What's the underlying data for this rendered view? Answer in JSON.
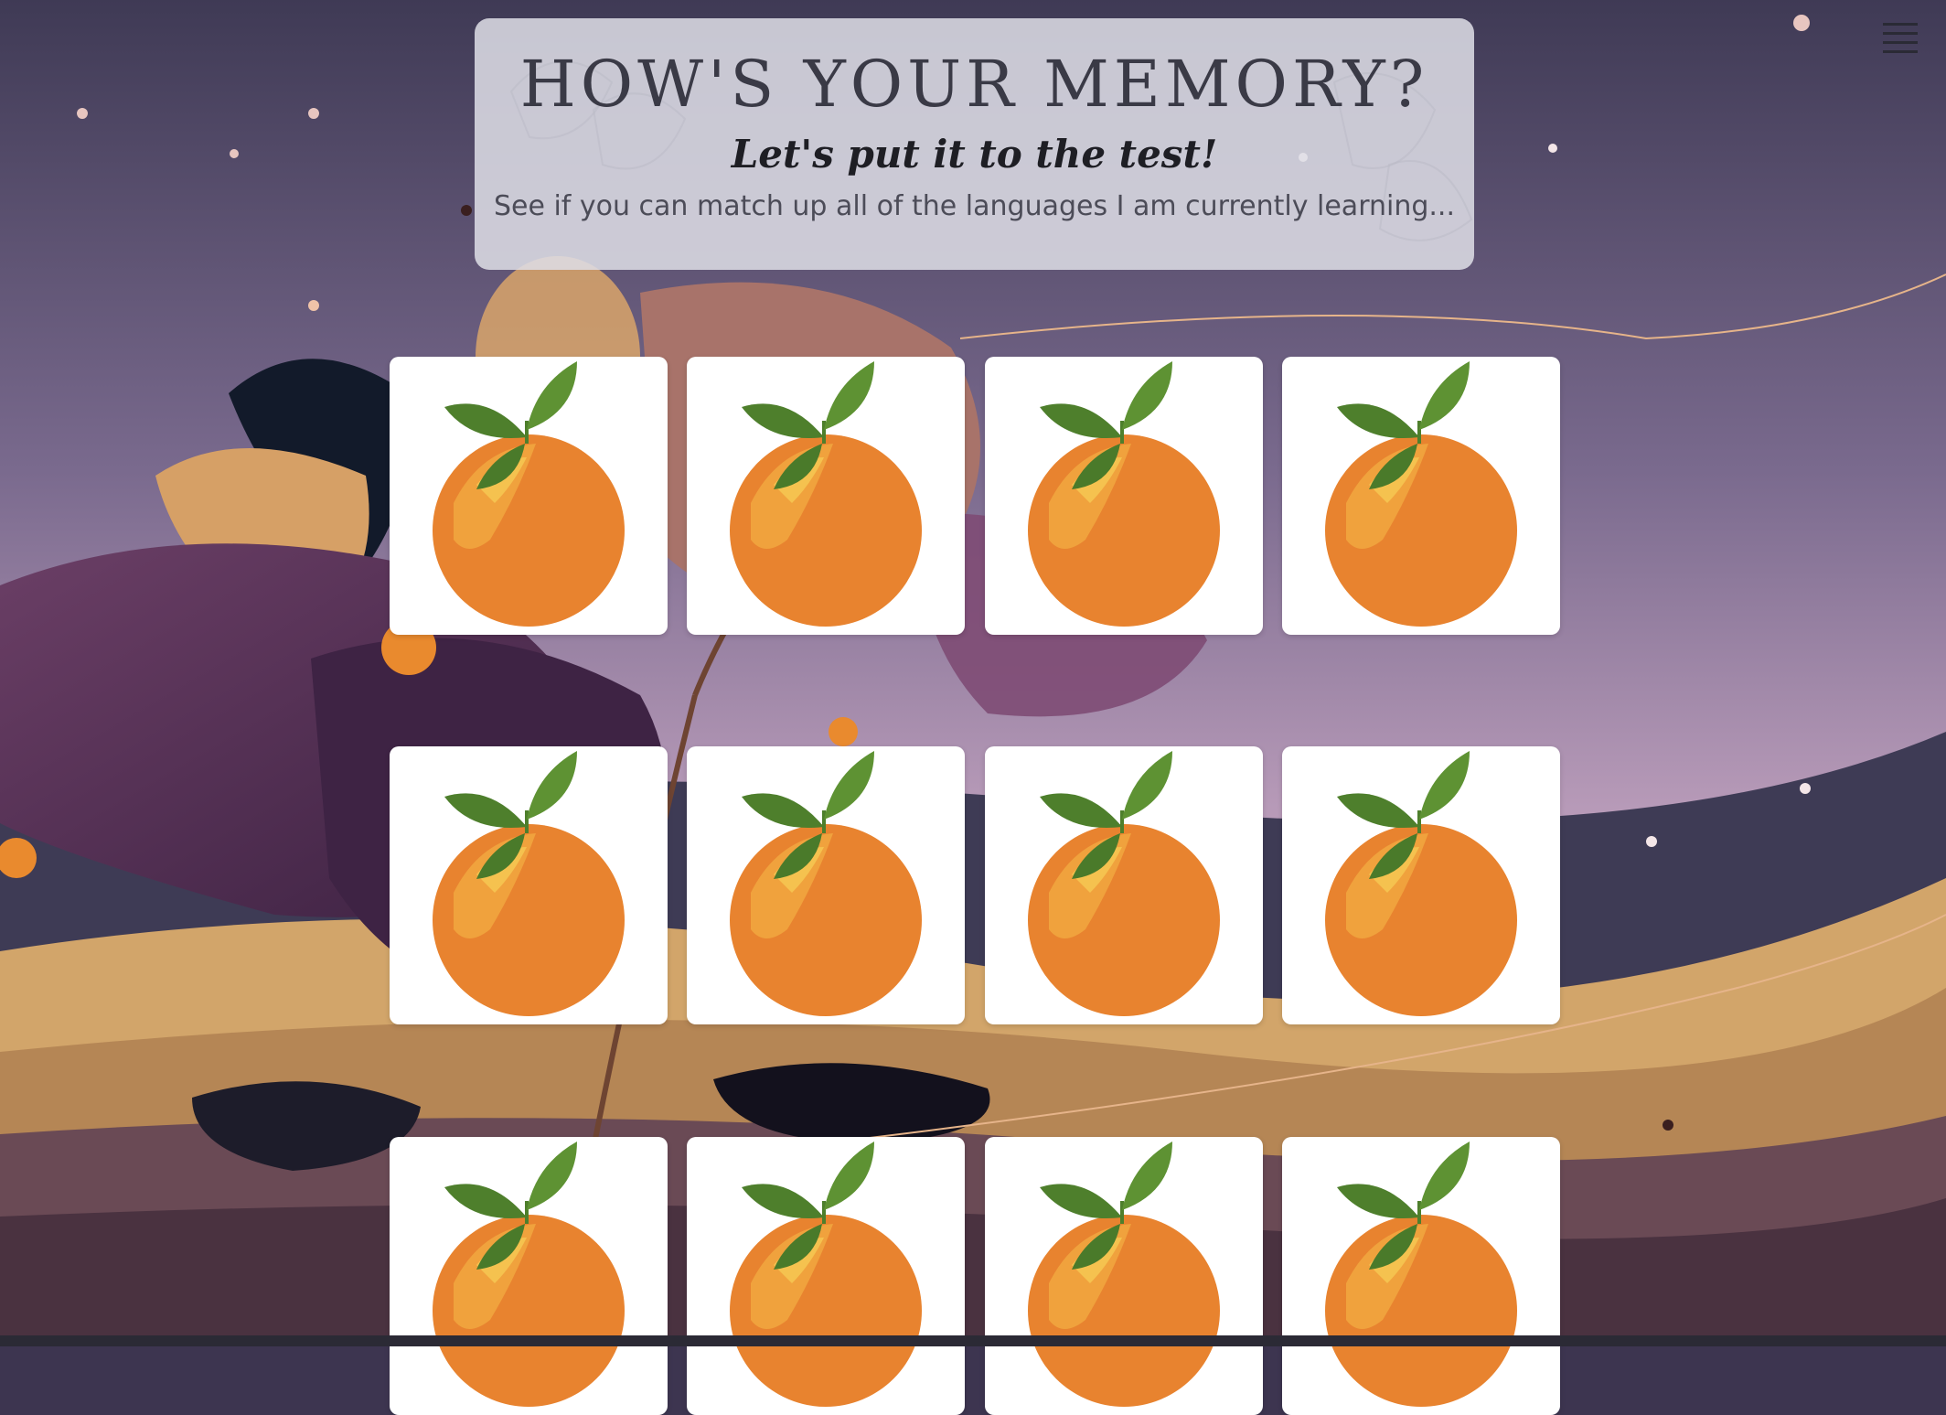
{
  "page": {
    "title": "HOW'S YOUR MEMORY?",
    "subtitle": "Let's put it to the test!",
    "description": "See if you can match up all of the languages I am currently learning..."
  },
  "menu": {
    "icon": "hamburger-menu-icon"
  },
  "cards": [
    {
      "icon": "orange-icon",
      "face": "down"
    },
    {
      "icon": "orange-icon",
      "face": "down"
    },
    {
      "icon": "orange-icon",
      "face": "down"
    },
    {
      "icon": "orange-icon",
      "face": "down"
    },
    {
      "icon": "orange-icon",
      "face": "down"
    },
    {
      "icon": "orange-icon",
      "face": "down"
    },
    {
      "icon": "orange-icon",
      "face": "down"
    },
    {
      "icon": "orange-icon",
      "face": "down"
    },
    {
      "icon": "orange-icon",
      "face": "down"
    },
    {
      "icon": "orange-icon",
      "face": "down"
    },
    {
      "icon": "orange-icon",
      "face": "down"
    },
    {
      "icon": "orange-icon",
      "face": "down"
    }
  ],
  "colors": {
    "sky_top": "#3f3a55",
    "sky_bottom": "#c9a6bf",
    "card_bg": "#ffffff",
    "orange": "#e8832f",
    "leaf": "#4e7f2c"
  }
}
